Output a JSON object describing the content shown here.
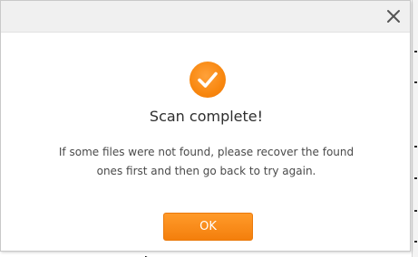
{
  "dialog": {
    "title": "Scan complete!",
    "message_line1": "If some files were not found, please recover the found",
    "message_line2": "ones first and then go back to try again.",
    "ok_label": "OK",
    "close_icon": "close-icon",
    "status_icon": "checkmark-icon"
  },
  "colors": {
    "accent": "#F7860F",
    "title_text": "#2E2E2E",
    "body_text": "#4A4A4A",
    "titlebar": "#F0F0F0"
  }
}
